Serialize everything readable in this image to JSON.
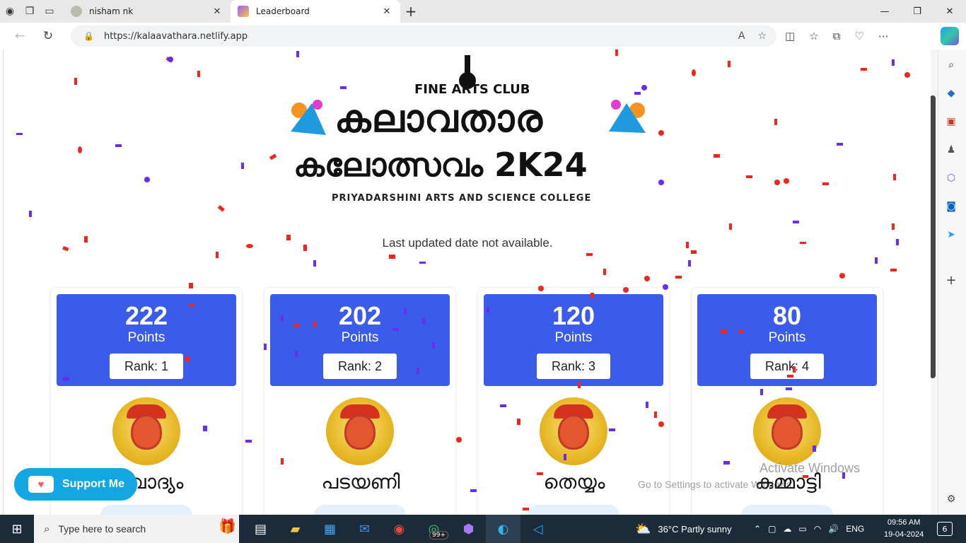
{
  "browser": {
    "tabs": [
      {
        "title": "nisham nk",
        "active": false
      },
      {
        "title": "Leaderboard",
        "active": true
      }
    ],
    "url": "https://kalaavathara.netlify.app"
  },
  "page": {
    "logo": {
      "club": "FINE ARTS CLUB",
      "title_malayalam": "കലാവതാര",
      "subtitle_malayalam": "കലോത്സവം 2K24",
      "college": "PRIYADARSHINI ARTS AND SCIENCE COLLEGE"
    },
    "last_updated": "Last updated date not available.",
    "cards": [
      {
        "points": "222",
        "points_label": "Points",
        "rank": "Rank: 1",
        "name": "ഖവാദ്യം"
      },
      {
        "points": "202",
        "points_label": "Points",
        "rank": "Rank: 2",
        "name": "പടയണി"
      },
      {
        "points": "120",
        "points_label": "Points",
        "rank": "Rank: 3",
        "name": "തെയ്യം"
      },
      {
        "points": "80",
        "points_label": "Points",
        "rank": "Rank: 4",
        "name": "കുമ്മാട്ടി"
      }
    ],
    "support_button": "Support Me",
    "watermark": {
      "line1": "Activate Windows",
      "line2": "Go to Settings to activate Windows."
    }
  },
  "taskbar": {
    "search_placeholder": "Type here to search",
    "whatsapp_badge": "99+",
    "weather": "36°C  Partly sunny",
    "language": "ENG",
    "time": "09:56 AM",
    "date": "19-04-2024",
    "notification_count": "6"
  },
  "colors": {
    "card_header": "#3b5bea",
    "support": "#13a6e3",
    "confetti_red": "#f0261d",
    "confetti_purple": "#6a2cf0"
  }
}
